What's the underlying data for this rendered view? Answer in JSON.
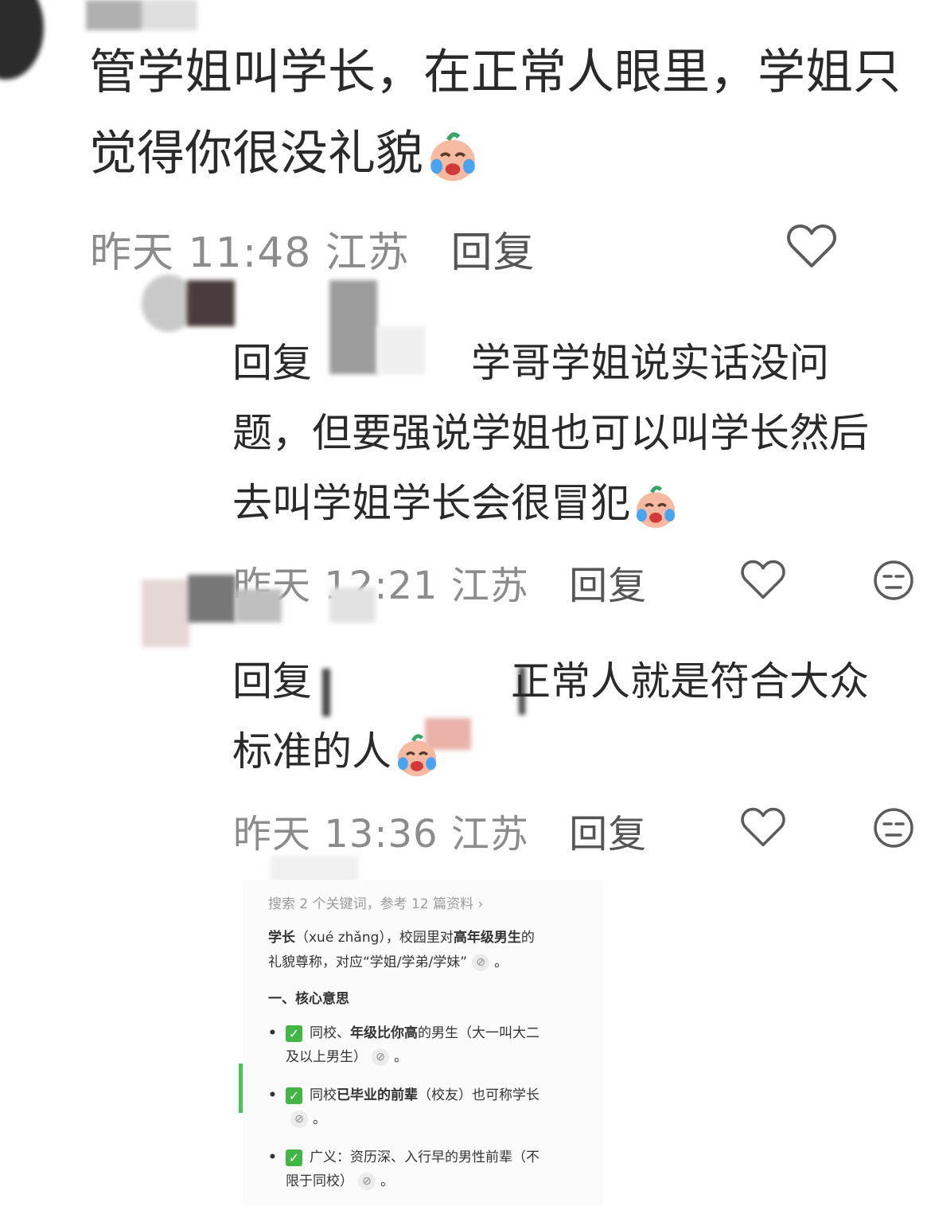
{
  "comments": [
    {
      "text_line1": "管学姐叫学长，在正常人眼里，学姐只",
      "text_line2": "觉得你很没礼貌",
      "time": "昨天 11:48",
      "location": "江苏",
      "reply_label": "回复"
    },
    {
      "reply_prefix": "回复",
      "text_line1": "学哥学姐说实话没问",
      "text_line2": "题，但要强说学姐也可以叫学长然后",
      "text_line3": "去叫学姐学长会很冒犯",
      "time": "昨天 12:21",
      "location": "江苏",
      "reply_label": "回复"
    },
    {
      "reply_prefix": "回复",
      "text_line1": "正常人就是符合大众",
      "text_line2": "标准的人",
      "time": "昨天 13:36",
      "location": "江苏",
      "reply_label": "回复"
    }
  ],
  "card": {
    "header": "搜索 2 个关键词，参考 12 篇资料 ›",
    "para_b1": "学长",
    "para_1": "（xué zhǎng），校园里对",
    "para_b2": "高年级男生",
    "para_2": "的",
    "para_3": "礼貌尊称，对应“学姐/学弟/学妹”",
    "period": "。",
    "section": "一、核心意思",
    "b1_a": "同校、",
    "b1_b": "年级比你高",
    "b1_c": "的男生（大一叫大二",
    "b1_d": "及以上男生）",
    "b2_a": "同校",
    "b2_b": "已毕业的前辈",
    "b2_c": "（校友）也可称学长",
    "b3_a": "广义：资历深、入行早的男性前辈（不",
    "b3_b": "限于同校）",
    "bullet_mark": "•",
    "check_mark": "✓",
    "link_glyph": "⊘"
  },
  "colors": {
    "meta_gray": "#8c8c8c",
    "check_green": "#43b544",
    "text": "#2a2a2a"
  },
  "icons": [
    "laughing-crying-emoji",
    "heart-icon",
    "meh-face-icon",
    "link-icon",
    "check-icon"
  ]
}
